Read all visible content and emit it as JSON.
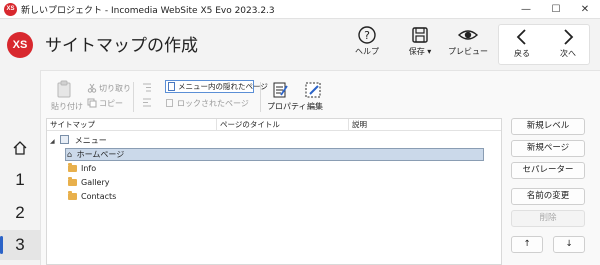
{
  "window": {
    "app_icon": "XS",
    "title": "新しいプロジェクト - Incomedia WebSite X5 Evo 2023.2.3",
    "minimize_icon": "minimize-icon",
    "maximize_icon": "maximize-icon",
    "close_icon": "close-icon"
  },
  "header": {
    "logo": "XS",
    "title": "サイトマップの作成",
    "buttons": {
      "help": "ヘルプ",
      "save": "保存",
      "preview": "プレビュー",
      "back": "戻る",
      "next": "次へ"
    }
  },
  "sidebar": {
    "steps": [
      "1",
      "2",
      "3"
    ],
    "active_step": "3"
  },
  "toolbar": {
    "paste": "貼り付け",
    "cut": "切り取り",
    "copy": "コピー",
    "hidden_pages": "メニュー内の隠れたページ",
    "locked_pages": "ロックされたページ",
    "properties": "プロパティ",
    "edit": "編集"
  },
  "table": {
    "columns": [
      "サイトマップ",
      "ページのタイトル",
      "説明"
    ],
    "root": "メニュー",
    "rows": [
      {
        "label": "ホームページ",
        "type": "page",
        "selected": true
      },
      {
        "label": "Info",
        "type": "folder"
      },
      {
        "label": "Gallery",
        "type": "folder"
      },
      {
        "label": "Contacts",
        "type": "folder"
      }
    ]
  },
  "actions": {
    "new_level": "新規レベル",
    "new_page": "新規ページ",
    "separator": "セパレーター",
    "rename": "名前の変更",
    "delete": "削除",
    "move_up": "↑",
    "move_down": "↓"
  },
  "colors": {
    "accent": "#2b63c7",
    "brand": "#d8282e",
    "selection": "#cbd9ea"
  }
}
